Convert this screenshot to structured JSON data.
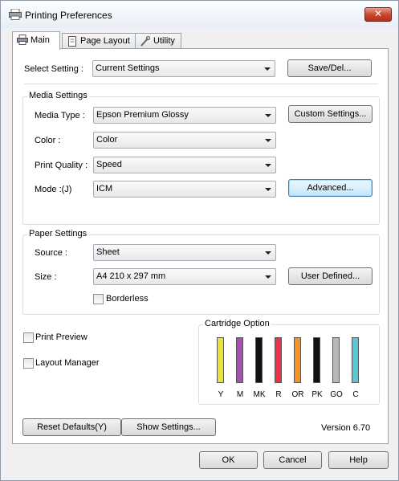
{
  "window": {
    "title": "Printing Preferences",
    "close_label": "✕"
  },
  "tabs": [
    {
      "label": "Main",
      "icon": "printer-icon"
    },
    {
      "label": "Page Layout",
      "icon": "page-icon"
    },
    {
      "label": "Utility",
      "icon": "wrench-icon"
    }
  ],
  "select_setting": {
    "label": "Select Setting :",
    "value": "Current Settings",
    "button": "Save/Del..."
  },
  "media_settings": {
    "title": "Media Settings",
    "media_type": {
      "label": "Media Type :",
      "value": "Epson Premium Glossy",
      "button": "Custom Settings..."
    },
    "color": {
      "label": "Color :",
      "value": "Color"
    },
    "print_quality": {
      "label": "Print Quality :",
      "value": "Speed"
    },
    "mode": {
      "label": "Mode :(J)",
      "value": "ICM",
      "button": "Advanced..."
    }
  },
  "paper_settings": {
    "title": "Paper Settings",
    "source": {
      "label": "Source :",
      "value": "Sheet"
    },
    "size": {
      "label": "Size :",
      "value": "A4 210 x 297 mm",
      "button": "User Defined..."
    },
    "borderless": {
      "label": "Borderless",
      "checked": false
    }
  },
  "print_preview": {
    "label": "Print Preview",
    "checked": false
  },
  "layout_manager": {
    "label": "Layout Manager",
    "checked": false
  },
  "cartridge": {
    "title": "Cartridge Option",
    "inks": [
      {
        "name": "Y",
        "color": "#e8e23a"
      },
      {
        "name": "M",
        "color": "#a64fb0"
      },
      {
        "name": "MK",
        "color": "#111111"
      },
      {
        "name": "R",
        "color": "#e8334a"
      },
      {
        "name": "OR",
        "color": "#f5922a"
      },
      {
        "name": "PK",
        "color": "#111111"
      },
      {
        "name": "GO",
        "color": "#b8b8b8"
      },
      {
        "name": "C",
        "color": "#5cc6d6"
      }
    ]
  },
  "footer": {
    "reset_label": "Reset Defaults(Y)",
    "show_settings_label": "Show Settings...",
    "version": "Version 6.70"
  },
  "dialog_buttons": {
    "ok": "OK",
    "cancel": "Cancel",
    "help": "Help"
  }
}
